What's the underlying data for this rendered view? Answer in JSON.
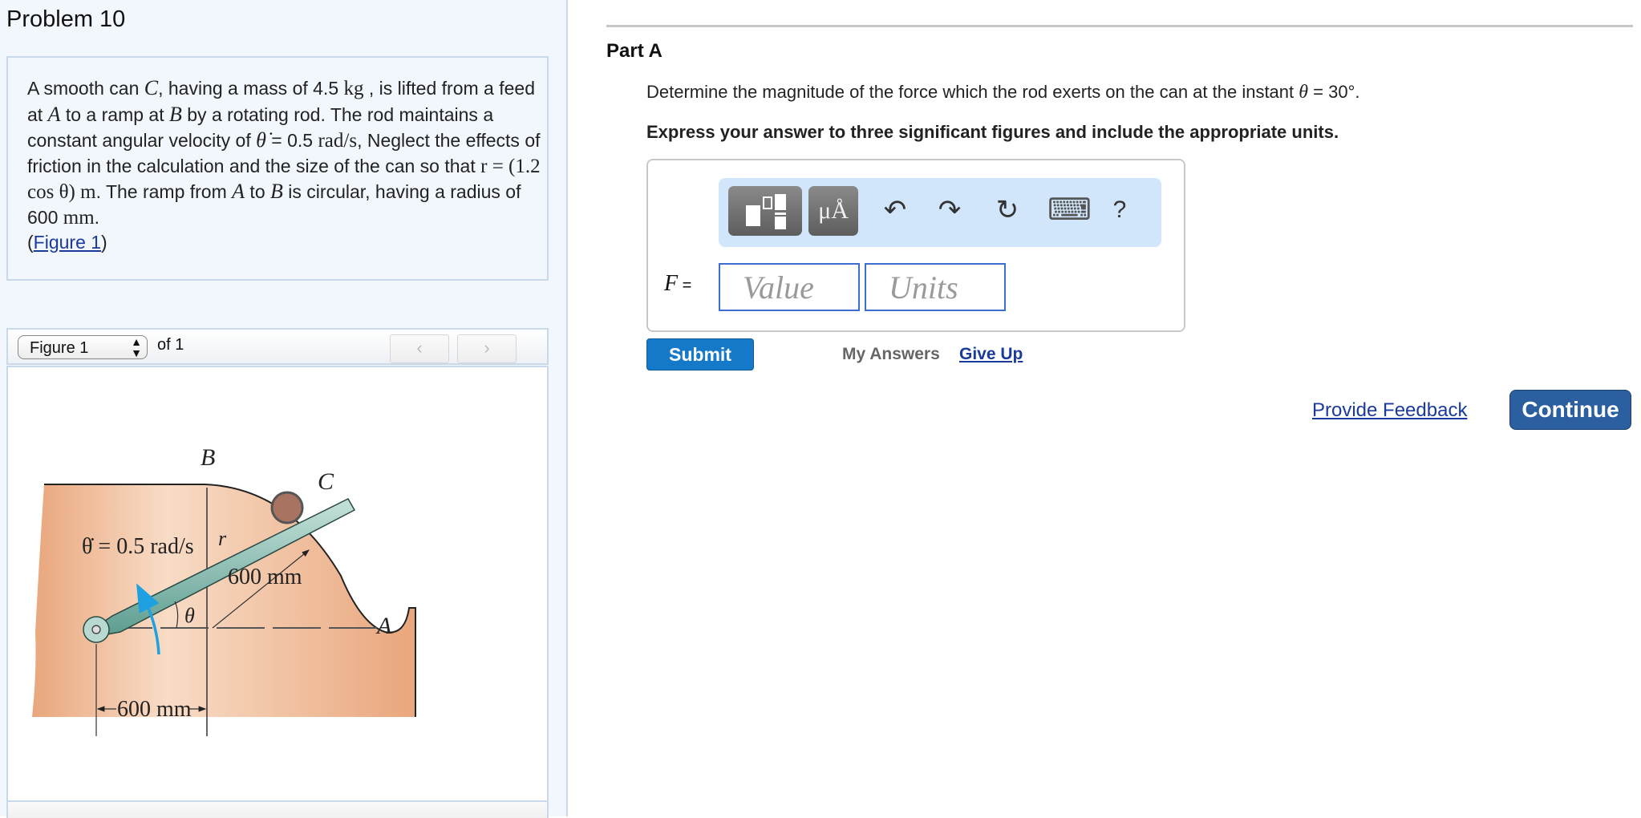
{
  "problem": {
    "title": "Problem 10",
    "text_parts": {
      "p1": "A smooth can ",
      "c": "C",
      "p2": ", having a mass of 4.5 ",
      "kg": "kg",
      "p3": " , is lifted from a feed at ",
      "a": "A",
      "p4": " to a ramp at ",
      "b": "B",
      "p5": " by a rotating rod. The rod maintains a constant angular velocity of ",
      "thetadot": "θ̇",
      "p6": " = 0.5 ",
      "rads": "rad/s",
      "p7": ", Neglect the effects of friction in the calculation and the size of the can so that ",
      "r_eq": "r = (1.2 cos θ) m",
      "p8": ". The ramp from ",
      "a2": "A",
      "p9": " to ",
      "b2": "B",
      "p10": " is circular, having a radius of 600 ",
      "mm": "mm",
      "p11": ".",
      "open_paren": "(",
      "figure_link": "Figure 1",
      "close_paren": ")"
    }
  },
  "figure_nav": {
    "selected": "Figure 1",
    "of_label": "of 1",
    "prev_icon": "‹",
    "next_icon": "›"
  },
  "figure": {
    "label_B": "B",
    "label_C": "C",
    "label_A": "A",
    "label_r": "r",
    "label_theta": "θ",
    "angular_velocity": "θ̇ = 0.5 rad/s",
    "radius_label": "600 mm",
    "distance_label": "600 mm",
    "colors": {
      "base": "#f0b892",
      "rod": "#8fc4b8",
      "can": "#a0705a",
      "arrow": "#1fa0e0"
    }
  },
  "part_a": {
    "part_label": "Part A",
    "question_pre": "Determine the magnitude of the force which the rod exerts on the can at the instant ",
    "question_var": "θ",
    "question_post": " = 30°.",
    "instructions": "Express your answer to three significant figures and include the appropriate units.",
    "toolbar": {
      "templates_icon": "templates-icon",
      "units_label": "μÅ",
      "undo_icon": "↶",
      "redo_icon": "↷",
      "reset_icon": "↻",
      "keyboard_icon": "⌨",
      "help_label": "?"
    },
    "variable": "F",
    "equals": " =",
    "value_placeholder": "Value",
    "units_placeholder": "Units",
    "submit_label": "Submit",
    "my_answers_label": "My Answers",
    "give_up_label": "Give Up"
  },
  "footer": {
    "feedback_label": "Provide Feedback",
    "continue_label": "Continue"
  }
}
